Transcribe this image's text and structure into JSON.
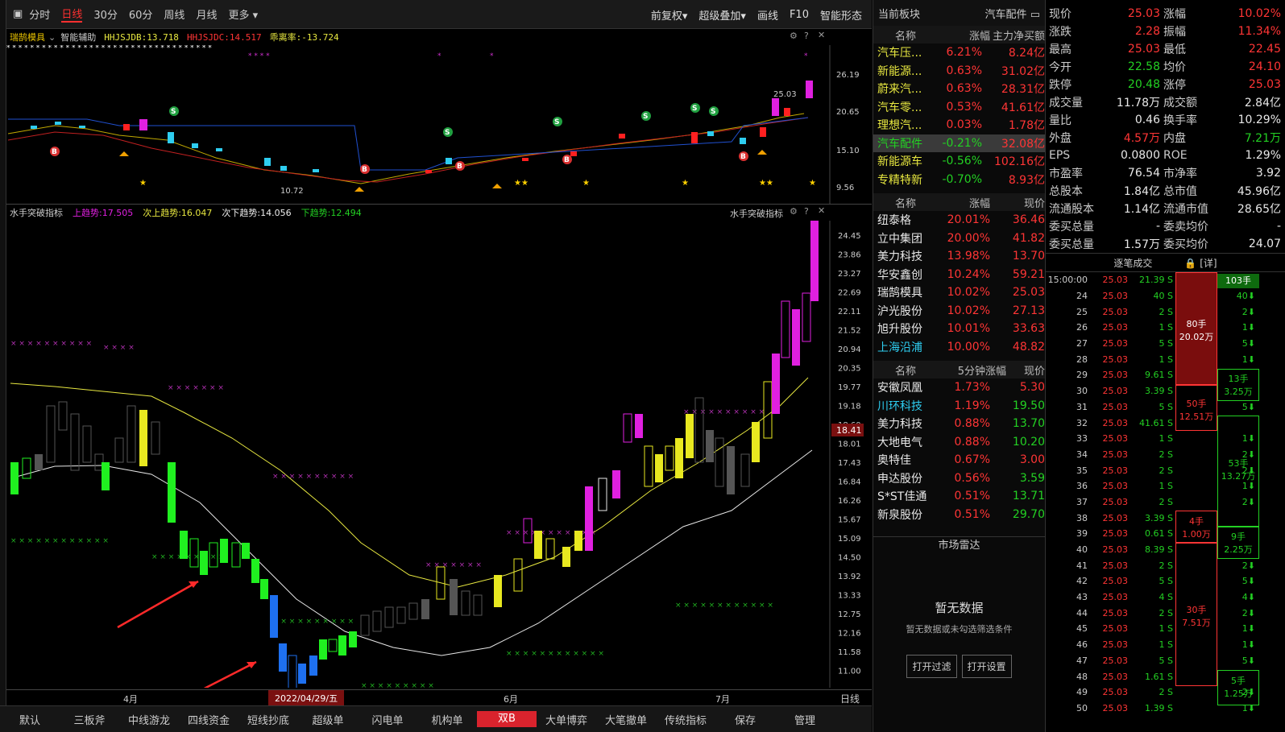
{
  "toolbar": {
    "left": [
      "分时",
      "日线",
      "30分",
      "60分",
      "周线",
      "月线",
      "更多"
    ],
    "right": [
      "前复权",
      "超级叠加",
      "画线",
      "F10",
      "智能形态"
    ]
  },
  "panel1": {
    "stock": "瑞鹄模具",
    "assist": "智能辅助",
    "ind1": "HHJSJDB:13.718",
    "ind2": "HHJSJDC:14.517",
    "ind3": "乖离率:-13.724",
    "price_label": "25.03",
    "low_label": "10.72",
    "yaxis": [
      "26.19",
      "20.65",
      "15.10",
      "9.56"
    ]
  },
  "panel2": {
    "name": "水手突破指标",
    "up": "上趋势:17.505",
    "sub_up": "次上趋势:16.047",
    "sub_down": "次下趋势:14.056",
    "down": "下趋势:12.494",
    "right_name": "水手突破指标",
    "current": "18.41",
    "yaxis": [
      "24.45",
      "23.86",
      "23.27",
      "22.69",
      "22.11",
      "21.52",
      "20.94",
      "20.35",
      "19.77",
      "19.18",
      "18.60",
      "18.01",
      "17.43",
      "16.84",
      "16.26",
      "15.67",
      "15.09",
      "14.50",
      "13.92",
      "13.33",
      "12.75",
      "12.16",
      "11.58",
      "11.00"
    ]
  },
  "xaxis": {
    "labels": [
      "4月",
      "2022/04/29/五",
      "6月",
      "7月"
    ],
    "right": "日线"
  },
  "bottom_tabs": [
    "默认",
    "三板斧",
    "中线游龙",
    "四线资金",
    "短线抄底",
    "超级单",
    "闪电单",
    "机构单",
    "双B",
    "大单博弈",
    "大笔撤单",
    "传统指标",
    "保存",
    "管理"
  ],
  "sector": {
    "title": "当前板块",
    "name": "汽车配件",
    "headers": [
      "名称",
      "涨幅",
      "主力净买额"
    ],
    "rows": [
      [
        "汽车压...",
        "6.21%",
        "8.24亿"
      ],
      [
        "新能源...",
        "0.63%",
        "31.02亿"
      ],
      [
        "蔚来汽...",
        "0.63%",
        "28.31亿"
      ],
      [
        "汽车零...",
        "0.53%",
        "41.61亿"
      ],
      [
        "理想汽...",
        "0.03%",
        "1.78亿"
      ],
      [
        "汽车配件",
        "-0.21%",
        "32.08亿"
      ],
      [
        "新能源车",
        "-0.56%",
        "102.16亿"
      ],
      [
        "专精特新",
        "-0.70%",
        "8.93亿"
      ]
    ]
  },
  "leaders": {
    "headers": [
      "名称",
      "涨幅",
      "现价"
    ],
    "rows": [
      [
        "纽泰格",
        "20.01%",
        "36.46"
      ],
      [
        "立中集团",
        "20.00%",
        "41.82"
      ],
      [
        "美力科技",
        "13.98%",
        "13.70"
      ],
      [
        "华安鑫创",
        "10.24%",
        "59.21"
      ],
      [
        "瑞鹄模具",
        "10.02%",
        "25.03"
      ],
      [
        "沪光股份",
        "10.02%",
        "27.13"
      ],
      [
        "旭升股份",
        "10.01%",
        "33.63"
      ],
      [
        "上海沿浦",
        "10.00%",
        "48.82"
      ]
    ]
  },
  "fivemin": {
    "headers": [
      "名称",
      "5分钟涨幅",
      "现价"
    ],
    "rows": [
      [
        "安徽凤凰",
        "1.73%",
        "5.30"
      ],
      [
        "川环科技",
        "1.19%",
        "19.50"
      ],
      [
        "美力科技",
        "0.88%",
        "13.70"
      ],
      [
        "大地电气",
        "0.88%",
        "10.20"
      ],
      [
        "奥特佳",
        "0.67%",
        "3.00"
      ],
      [
        "申达股份",
        "0.56%",
        "3.59"
      ],
      [
        "S*ST佳通",
        "0.51%",
        "13.71"
      ],
      [
        "新泉股份",
        "0.51%",
        "29.70"
      ]
    ]
  },
  "radar": {
    "title": "市场雷达",
    "empty": "暂无数据",
    "hint": "暂无数据或未勾选筛选条件",
    "btn1": "打开过滤",
    "btn2": "打开设置"
  },
  "quote": [
    [
      "现价",
      "25.03",
      "涨幅",
      "10.02%"
    ],
    [
      "涨跌",
      "2.28",
      "振幅",
      "11.34%"
    ],
    [
      "最高",
      "25.03",
      "最低",
      "22.45"
    ],
    [
      "今开",
      "22.58",
      "均价",
      "24.10"
    ],
    [
      "跌停",
      "20.48",
      "涨停",
      "25.03"
    ],
    [
      "成交量",
      "11.78万",
      "成交额",
      "2.84亿"
    ],
    [
      "量比",
      "0.46",
      "换手率",
      "10.29%"
    ],
    [
      "外盘",
      "4.57万",
      "内盘",
      "7.21万"
    ],
    [
      "EPS",
      "0.0800",
      "ROE",
      "1.29%"
    ],
    [
      "市盈率",
      "76.54",
      "市净率",
      "3.92"
    ],
    [
      "总股本",
      "1.84亿",
      "总市值",
      "45.96亿"
    ],
    [
      "流通股本",
      "1.14亿",
      "流通市值",
      "28.65亿"
    ],
    [
      "委买总量",
      "-",
      "委卖均价",
      "-"
    ],
    [
      "委买总量",
      "1.57万",
      "委买均价",
      "24.07"
    ]
  ],
  "ticks_title": "逐笔成交",
  "ticks_detail": "[详]",
  "ticks": [
    [
      "15:00:00",
      "25.03",
      "21.39 S"
    ],
    [
      "24",
      "25.03",
      "40 S"
    ],
    [
      "25",
      "25.03",
      "2 S"
    ],
    [
      "26",
      "25.03",
      "1 S"
    ],
    [
      "27",
      "25.03",
      "5 S"
    ],
    [
      "28",
      "25.03",
      "1 S"
    ],
    [
      "29",
      "25.03",
      "9.61 S"
    ],
    [
      "30",
      "25.03",
      "3.39 S"
    ],
    [
      "31",
      "25.03",
      "5 S"
    ],
    [
      "32",
      "25.03",
      "41.61 S"
    ],
    [
      "33",
      "25.03",
      "1 S"
    ],
    [
      "34",
      "25.03",
      "2 S"
    ],
    [
      "35",
      "25.03",
      "2 S"
    ],
    [
      "36",
      "25.03",
      "1 S"
    ],
    [
      "37",
      "25.03",
      "2 S"
    ],
    [
      "38",
      "25.03",
      "3.39 S"
    ],
    [
      "39",
      "25.03",
      "0.61 S"
    ],
    [
      "40",
      "25.03",
      "8.39 S"
    ],
    [
      "41",
      "25.03",
      "2 S"
    ],
    [
      "42",
      "25.03",
      "5 S"
    ],
    [
      "43",
      "25.03",
      "4 S"
    ],
    [
      "44",
      "25.03",
      "2 S"
    ],
    [
      "45",
      "25.03",
      "1 S"
    ],
    [
      "46",
      "25.03",
      "1 S"
    ],
    [
      "47",
      "25.03",
      "5 S"
    ],
    [
      "48",
      "25.03",
      "1.61 S"
    ],
    [
      "49",
      "25.03",
      "2 S"
    ],
    [
      "50",
      "25.03",
      "1.39 S"
    ]
  ],
  "ticks_side": [
    "1",
    "40",
    "2",
    "1",
    "5",
    "1",
    "",
    "",
    "5",
    "",
    "1",
    "2",
    "2",
    "1",
    "2",
    "",
    "",
    "",
    "2",
    "5",
    "4",
    "2",
    "1",
    "1",
    "5",
    "",
    "2",
    "1"
  ],
  "orderblocks": [
    [
      "80手",
      "20.02万"
    ],
    [
      "50手",
      "12.51万"
    ],
    [
      "4手",
      "1.00万"
    ],
    [
      "30手",
      "7.51万"
    ]
  ],
  "rightblocks": [
    [
      "103手"
    ],
    [
      "13手",
      "3.25万"
    ],
    [
      "53手",
      "13.27万"
    ],
    [
      "9手",
      "2.25万"
    ],
    [
      "5手",
      "1.25万"
    ]
  ]
}
